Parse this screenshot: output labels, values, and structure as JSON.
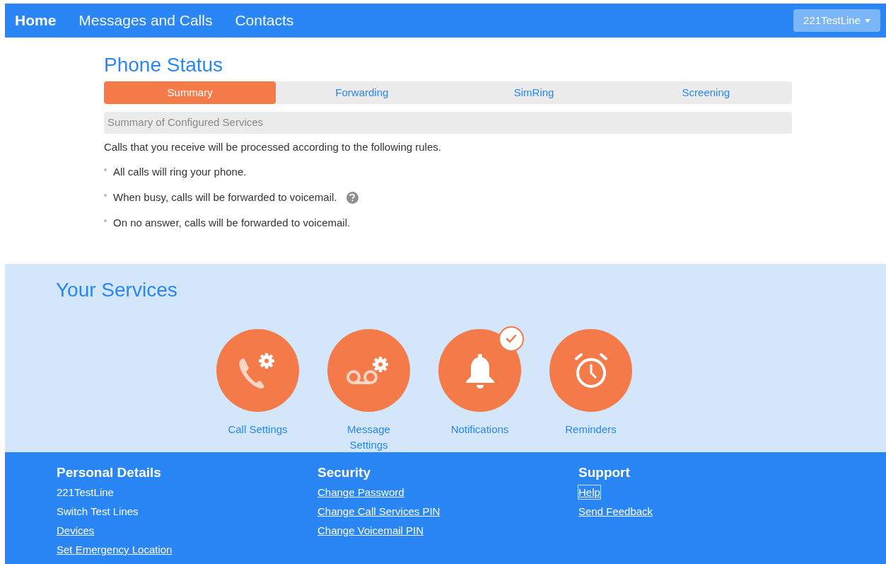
{
  "nav": {
    "items": [
      {
        "label": "Home",
        "selected": true
      },
      {
        "label": "Messages and Calls",
        "selected": false
      },
      {
        "label": "Contacts",
        "selected": false
      }
    ],
    "account": "221TestLine"
  },
  "phone_status": {
    "title": "Phone Status",
    "tabs": [
      {
        "label": "Summary",
        "selected": true
      },
      {
        "label": "Forwarding",
        "selected": false
      },
      {
        "label": "SimRing",
        "selected": false
      },
      {
        "label": "Screening",
        "selected": false
      }
    ],
    "section_header": "Summary of Configured Services",
    "intro": "Calls that you receive will be processed according to the following rules.",
    "rules": [
      {
        "text": "All calls will ring your phone.",
        "help": false
      },
      {
        "text": "When busy, calls will be forwarded to voicemail.",
        "help": true
      },
      {
        "text": "On no answer, calls will be forwarded to voicemail.",
        "help": false
      }
    ]
  },
  "services": {
    "title": "Your Services",
    "items": [
      {
        "kind": "call",
        "label": "Call Settings",
        "checked": false
      },
      {
        "kind": "message",
        "label": "Message Settings",
        "checked": false
      },
      {
        "kind": "bell",
        "label": "Notifications",
        "checked": true
      },
      {
        "kind": "alarm",
        "label": "Reminders",
        "checked": false
      }
    ]
  },
  "footer": {
    "columns": [
      {
        "title": "Personal Details",
        "links": [
          {
            "text": "221TestLine",
            "kind": "text",
            "focused": false
          },
          {
            "text": "Switch Test Lines",
            "kind": "text",
            "focused": false
          },
          {
            "text": "Devices",
            "kind": "link",
            "focused": false
          },
          {
            "text": "Set Emergency Location",
            "kind": "link",
            "focused": false
          }
        ]
      },
      {
        "title": "Security",
        "links": [
          {
            "text": "Change Password",
            "kind": "link",
            "focused": false
          },
          {
            "text": "Change Call Services PIN",
            "kind": "link",
            "focused": false
          },
          {
            "text": "Change Voicemail PIN",
            "kind": "link",
            "focused": false
          }
        ]
      },
      {
        "title": "Support",
        "links": [
          {
            "text": "Help",
            "kind": "link",
            "focused": true
          },
          {
            "text": "Send Feedback",
            "kind": "link",
            "focused": false
          }
        ]
      }
    ]
  }
}
